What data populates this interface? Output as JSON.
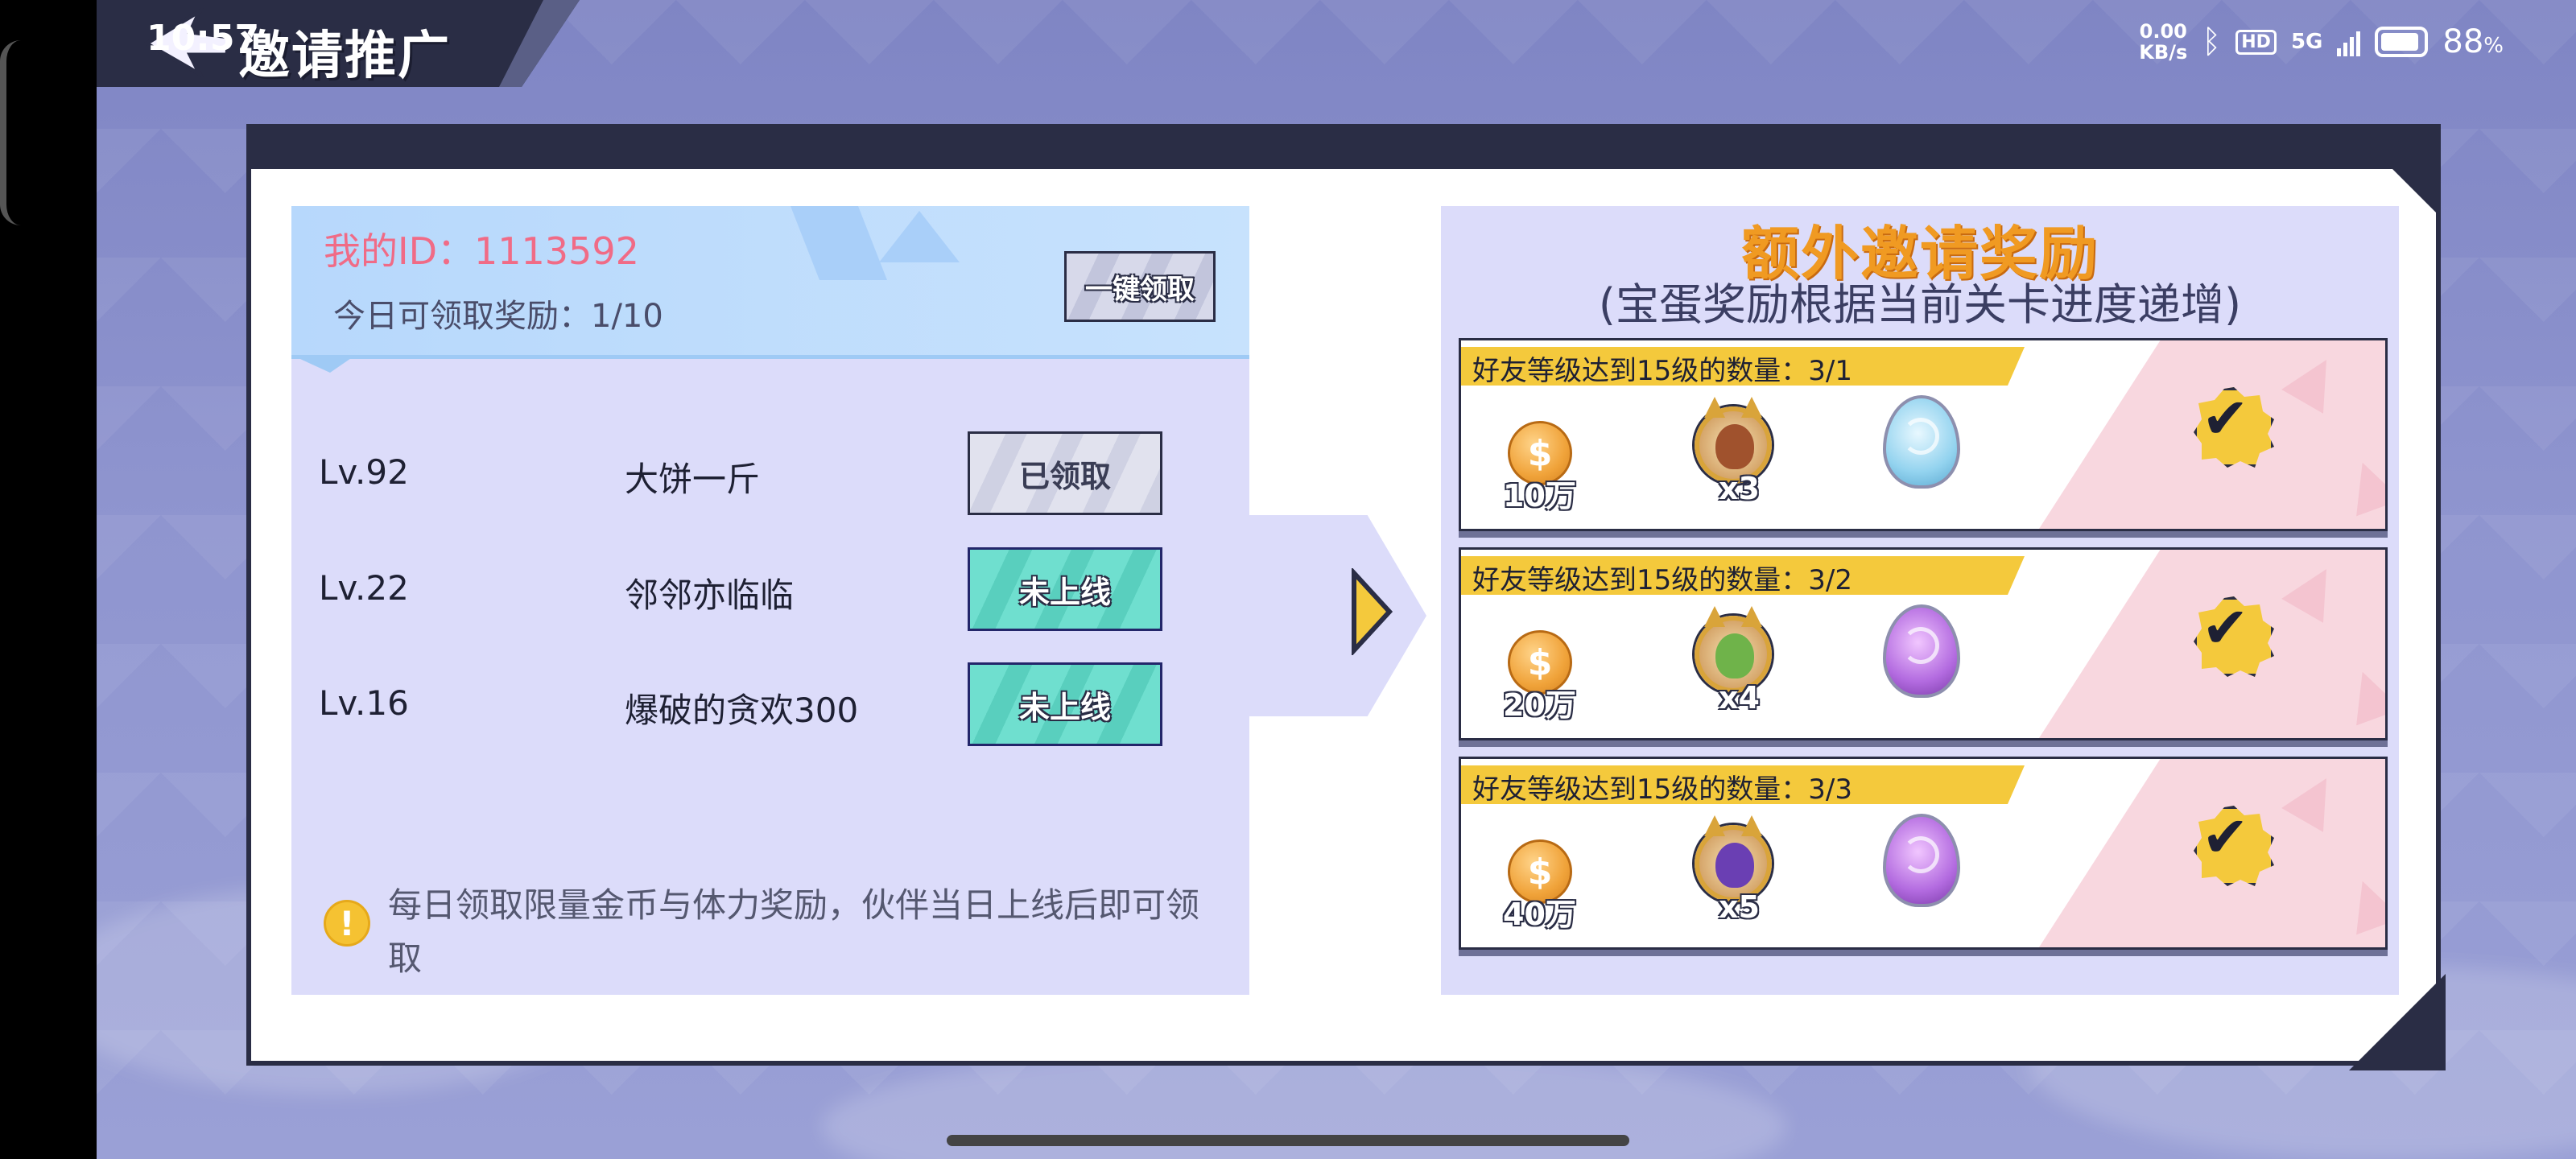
{
  "header": {
    "clock": "10:57",
    "title": "邀请推广"
  },
  "status_bar": {
    "speed_value": "0.00",
    "speed_unit": "KB/s",
    "hd": "HD",
    "network": "5G",
    "battery_pct": "88",
    "battery_unit": "%",
    "battery_level": 0.88
  },
  "invite": {
    "my_id": "我的ID：1113592",
    "daily_claim": "今日可领取奖励：1/10",
    "claim_all_label": "一键领取",
    "friends": [
      {
        "level": "Lv.92",
        "name": "大饼一斤",
        "status": "已领取"
      },
      {
        "level": "Lv.22",
        "name": "邻邻亦临临",
        "status": "未上线"
      },
      {
        "level": "Lv.16",
        "name": "爆破的贪欢300",
        "status": "未上线"
      }
    ],
    "tip": "每日领取限量金币与体力奖励，伙伴当日上线后即可领取"
  },
  "bonus": {
    "title": "额外邀请奖励",
    "subtitle": "(宝蛋奖励根据当前关卡进度递增)",
    "cards": [
      {
        "condition": "好友等级达到15级的数量：3/1",
        "coins": "10万",
        "characters": "x3",
        "egg": "ice-egg-icon"
      },
      {
        "condition": "好友等级达到15级的数量：3/2",
        "coins": "20万",
        "characters": "x4",
        "egg": "purple-egg-icon"
      },
      {
        "condition": "好友等级达到15级的数量：3/3",
        "coins": "40万",
        "characters": "x5",
        "egg": "purple-egg-icon"
      }
    ]
  },
  "colors": {
    "accent_pink": "#f06b86",
    "title_orange": "#f09a22",
    "offline_teal": "#6fdfcf",
    "condition_yellow": "#f4c93c",
    "panel_dark": "#2a2d45"
  }
}
